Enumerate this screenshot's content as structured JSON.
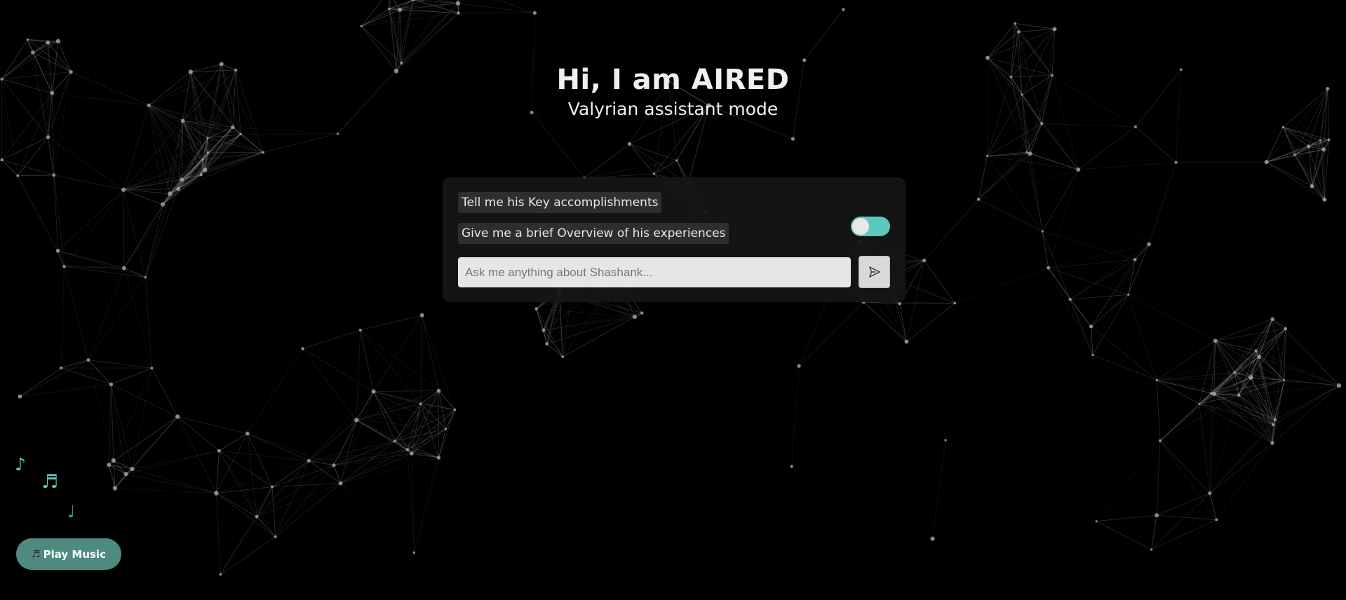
{
  "hero": {
    "title": "Hi, I am AIRED",
    "subtitle": "Valyrian assistant mode"
  },
  "chat": {
    "suggestions": [
      "Tell me his Key accomplishments",
      "Give me a brief Overview of his experiences"
    ],
    "input_placeholder": "Ask me anything about Shashank...",
    "input_value": "",
    "toggle_on": true,
    "send_icon": "send-arrow-icon"
  },
  "music": {
    "play_label": "Play Music",
    "button_icon": "music-notes-icon",
    "notes": [
      "♪",
      "♬",
      "♩"
    ]
  },
  "colors": {
    "background": "#000000",
    "accent": "#5cc9bc",
    "play_button": "#4f8a80",
    "panel": "#161616",
    "suggestion_bg": "#2e2e2e"
  }
}
